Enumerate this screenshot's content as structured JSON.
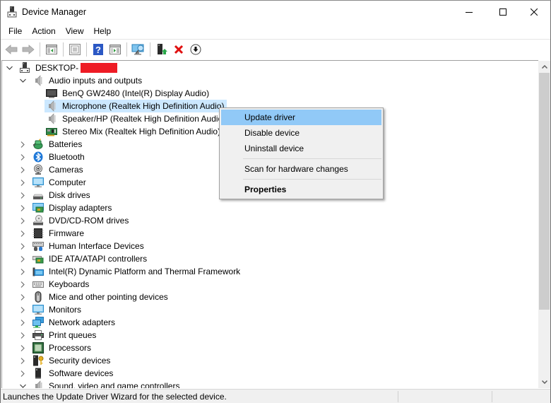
{
  "window": {
    "title": "Device Manager",
    "icon": "device-manager-icon",
    "controls": [
      "minimize-icon",
      "maximize-icon",
      "close-icon"
    ]
  },
  "menubar": {
    "items": [
      {
        "label": "File"
      },
      {
        "label": "Action"
      },
      {
        "label": "View"
      },
      {
        "label": "Help"
      }
    ]
  },
  "toolbar": {
    "buttons": [
      {
        "name": "back",
        "icon": "arrow-left-icon"
      },
      {
        "name": "forward",
        "icon": "arrow-right-icon"
      },
      {
        "name": "show-hide-console-tree",
        "icon": "console-tree-icon"
      },
      {
        "name": "properties",
        "icon": "properties-icon"
      },
      {
        "name": "help",
        "icon": "help-icon"
      },
      {
        "name": "show-hide-action-pane",
        "icon": "action-pane-icon"
      },
      {
        "name": "scan-hardware",
        "icon": "scan-monitor-icon"
      },
      {
        "name": "update-driver",
        "icon": "update-driver-icon"
      },
      {
        "name": "uninstall-device",
        "icon": "red-x-icon"
      },
      {
        "name": "disable-device",
        "icon": "down-arrow-circle-icon"
      }
    ]
  },
  "tree": {
    "root": {
      "label": "DESKTOP-",
      "redacted": true,
      "expanded": true,
      "icon": "computer-tower-icon"
    },
    "categories": [
      {
        "label": "Audio inputs and outputs",
        "icon": "speaker-icon",
        "expanded": true,
        "children": [
          {
            "label": "BenQ GW2480 (Intel(R) Display Audio)",
            "icon": "monitor-dark-icon"
          },
          {
            "label": "Microphone (Realtek High Definition Audio)",
            "icon": "speaker-icon",
            "selected": true
          },
          {
            "label": "Speaker/HP (Realtek High Definition Audio)",
            "icon": "speaker-icon"
          },
          {
            "label": "Stereo Mix (Realtek High Definition Audio)",
            "icon": "sound-card-icon"
          }
        ]
      },
      {
        "label": "Batteries",
        "icon": "battery-icon",
        "expanded": false
      },
      {
        "label": "Bluetooth",
        "icon": "bluetooth-icon",
        "expanded": false
      },
      {
        "label": "Cameras",
        "icon": "webcam-icon",
        "expanded": false
      },
      {
        "label": "Computer",
        "icon": "monitor-icon",
        "expanded": false
      },
      {
        "label": "Disk drives",
        "icon": "disk-drive-icon",
        "expanded": false
      },
      {
        "label": "Display adapters",
        "icon": "display-adapter-icon",
        "expanded": false
      },
      {
        "label": "DVD/CD-ROM drives",
        "icon": "dvd-drive-icon",
        "expanded": false
      },
      {
        "label": "Firmware",
        "icon": "chip-icon",
        "expanded": false
      },
      {
        "label": "Human Interface Devices",
        "icon": "hid-icon",
        "expanded": false
      },
      {
        "label": "IDE ATA/ATAPI controllers",
        "icon": "ide-controller-icon",
        "expanded": false
      },
      {
        "label": "Intel(R) Dynamic Platform and Thermal Framework",
        "icon": "folder-monitor-icon",
        "expanded": false
      },
      {
        "label": "Keyboards",
        "icon": "keyboard-icon",
        "expanded": false
      },
      {
        "label": "Mice and other pointing devices",
        "icon": "mouse-icon",
        "expanded": false
      },
      {
        "label": "Monitors",
        "icon": "monitor-icon",
        "expanded": false
      },
      {
        "label": "Network adapters",
        "icon": "network-icon",
        "expanded": false
      },
      {
        "label": "Print queues",
        "icon": "printer-icon",
        "expanded": false
      },
      {
        "label": "Processors",
        "icon": "processor-icon",
        "expanded": false
      },
      {
        "label": "Security devices",
        "icon": "security-key-icon",
        "expanded": false
      },
      {
        "label": "Software devices",
        "icon": "software-device-icon",
        "expanded": false
      },
      {
        "label": "Sound, video and game controllers",
        "icon": "speaker-icon",
        "expanded": true
      }
    ]
  },
  "context_menu": {
    "items": [
      {
        "label": "Update driver",
        "highlighted": true
      },
      {
        "label": "Disable device"
      },
      {
        "label": "Uninstall device"
      },
      {
        "separator": true
      },
      {
        "label": "Scan for hardware changes"
      },
      {
        "separator": true
      },
      {
        "label": "Properties",
        "bold": true
      }
    ]
  },
  "scrollbar": {
    "position_fraction": 0.0,
    "visible_fraction": 0.78
  },
  "statusbar": {
    "text": "Launches the Update Driver Wizard for the selected device."
  },
  "colors": {
    "selection": "#cce8ff",
    "menu_highlight": "#91c9f7",
    "redaction": "#ee1c25"
  }
}
